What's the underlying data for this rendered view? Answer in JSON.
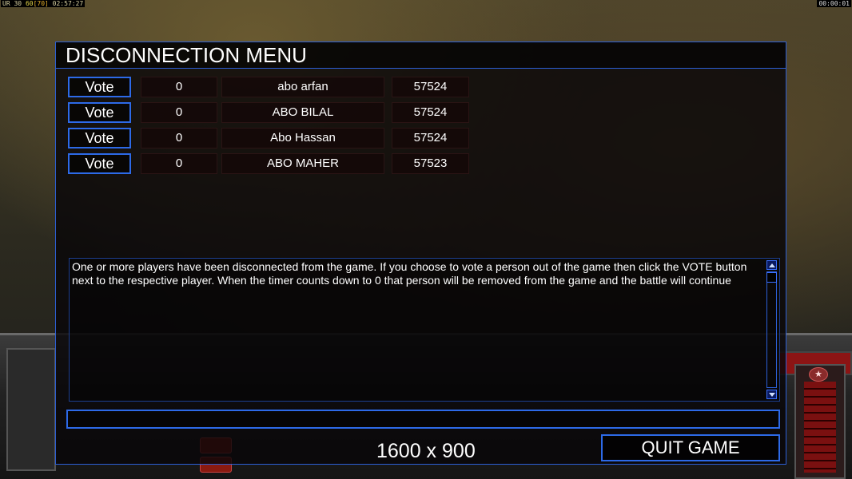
{
  "overlay": {
    "top_left": {
      "part1": "UR",
      "part2": "30",
      "part3": "60",
      "part4": "[70]",
      "time": "02:57:27"
    },
    "top_right": "00:00:01"
  },
  "menu": {
    "title": "DISCONNECTION MENU",
    "players": [
      {
        "vote_label": "Vote",
        "timer": "0",
        "name": "abo arfan",
        "ping": "57524"
      },
      {
        "vote_label": "Vote",
        "timer": "0",
        "name": "ABO BILAL",
        "ping": "57524"
      },
      {
        "vote_label": "Vote",
        "timer": "0",
        "name": "Abo Hassan",
        "ping": "57524"
      },
      {
        "vote_label": "Vote",
        "timer": "0",
        "name": "ABO MAHER",
        "ping": "57523"
      }
    ],
    "message": "One or more players have been disconnected from the game. If you choose to vote a person out of the game then click the VOTE button next to the respective player. When the timer counts down to 0 that person will be removed from the game and the battle will continue",
    "quit_label": "QUIT GAME",
    "resolution_label": "1600 x 900"
  },
  "colors": {
    "accent_border": "#2d6ae8",
    "panel_bg": "#08060a",
    "text": "#ffffff"
  }
}
